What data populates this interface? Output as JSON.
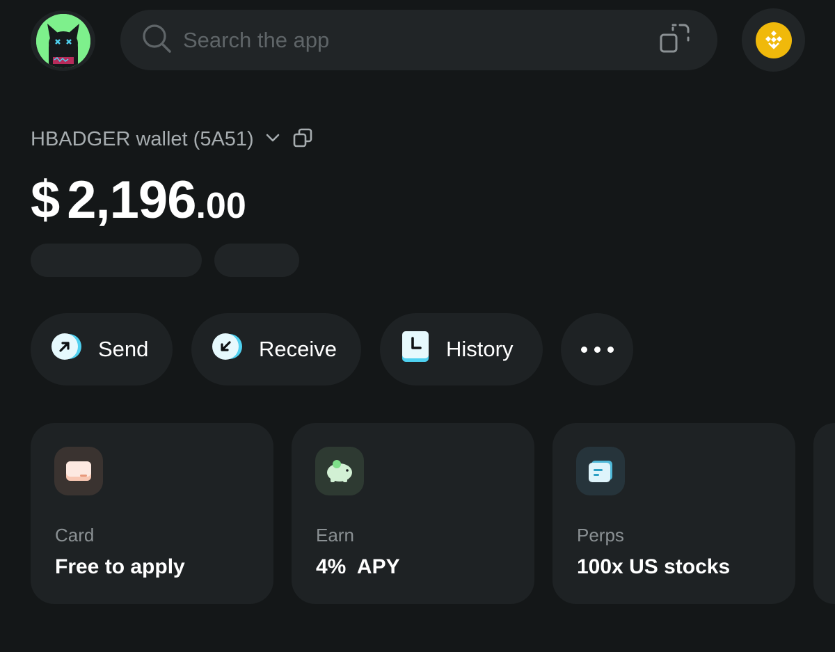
{
  "header": {
    "search": {
      "placeholder": "Search the app"
    },
    "network": {
      "name": "BNB Chain",
      "color": "#F0B90B"
    }
  },
  "wallet": {
    "name": "HBADGER wallet (5A51)",
    "balance": {
      "currency": "$",
      "integer": "2,196",
      "decimal": ".00"
    }
  },
  "actions": [
    {
      "label": "Send",
      "icon": "arrow-up-right-icon"
    },
    {
      "label": "Receive",
      "icon": "arrow-down-left-icon"
    },
    {
      "label": "History",
      "icon": "clock-icon"
    },
    {
      "label": "More",
      "icon": "more-dots-icon"
    }
  ],
  "cards": [
    {
      "label": "Card",
      "value": "Free to apply",
      "icon": "card-icon",
      "icon_color": "#F8C7B3"
    },
    {
      "label": "Earn",
      "value": "4%  APY",
      "icon": "piggy-bank-icon",
      "icon_color": "#D2F0D4"
    },
    {
      "label": "Perps",
      "value": "100x US stocks",
      "icon": "chart-doc-icon",
      "icon_color": "#7FD6F2"
    }
  ],
  "colors": {
    "background": "#141718",
    "surface": "#1E2224",
    "text_primary": "#FFFFFF",
    "text_secondary": "#A7ADB0",
    "accent_cyan": "#4FD1F0"
  }
}
